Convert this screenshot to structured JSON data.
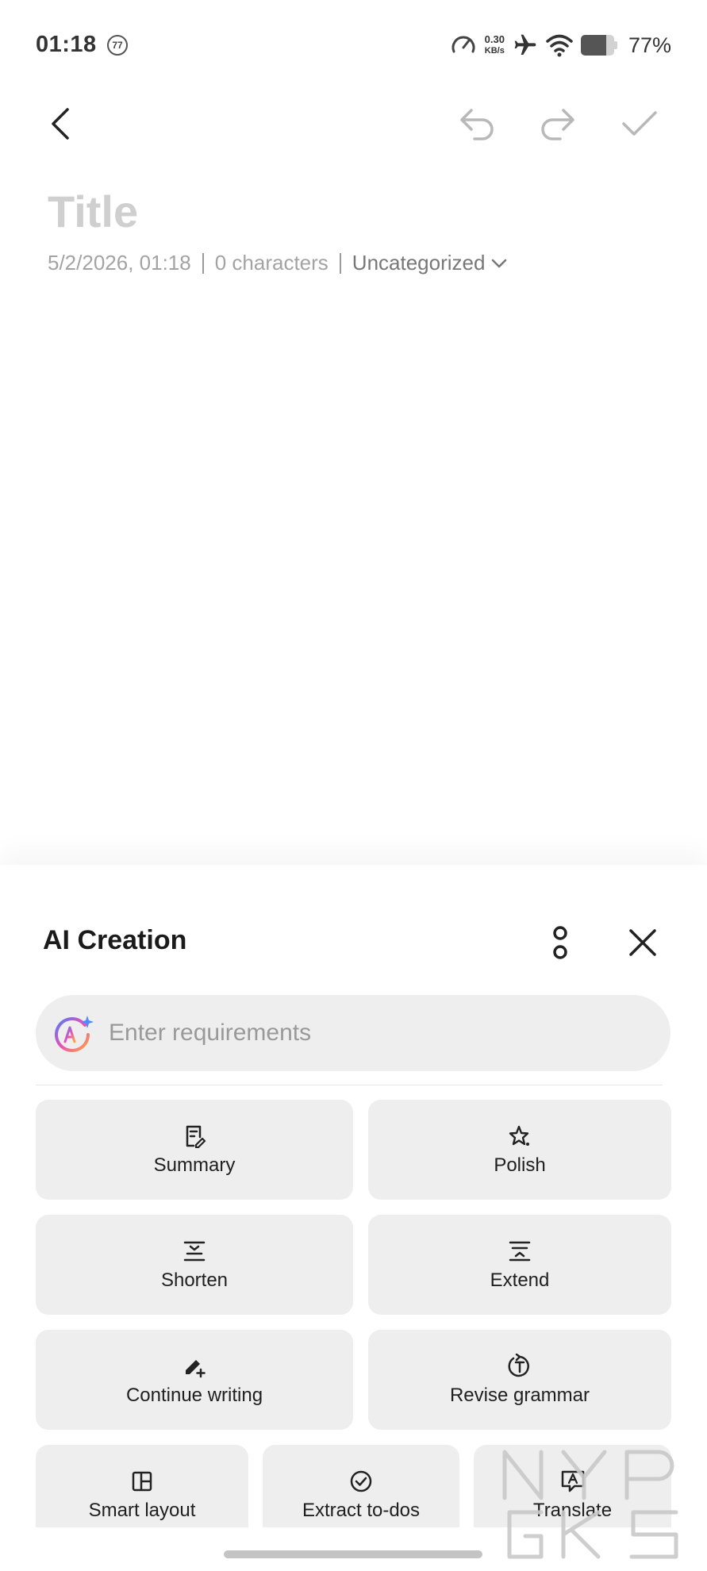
{
  "status_bar": {
    "time": "01:18",
    "notification_count": "77",
    "net_speed_value": "0.30",
    "net_speed_unit": "KB/s",
    "battery_percent": "77%",
    "battery_level": 0.77
  },
  "note": {
    "title_placeholder": "Title",
    "date": "5/2/2026, 01:18",
    "characters": "0 characters",
    "category": "Uncategorized"
  },
  "ai_panel": {
    "title": "AI Creation",
    "input_placeholder": "Enter requirements",
    "actions": {
      "summary": "Summary",
      "polish": "Polish",
      "shorten": "Shorten",
      "extend": "Extend",
      "continue_writing": "Continue writing",
      "revise_grammar": "Revise grammar",
      "smart_layout": "Smart layout",
      "extract_todos": "Extract to-dos",
      "translate": "Translate"
    }
  },
  "watermark": {
    "line1": "NYP",
    "line2": "GKS"
  },
  "colors": {
    "chip_bg": "#eeeeee",
    "title_placeholder": "#cfcfcf",
    "icon_muted": "#b8b8b8"
  }
}
